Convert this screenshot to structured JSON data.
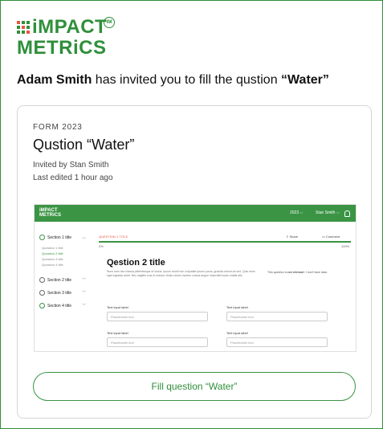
{
  "brand": {
    "line1": "iMPACT",
    "line2": "METRiCS",
    "tm": "IM"
  },
  "invite": {
    "inviter": "Adam Smith",
    "text_before": " has invited you to fill the qustion ",
    "question": "“Water”"
  },
  "card": {
    "form_label": "FORM 2023",
    "title": "Qustion “Water”",
    "invited_by": "Invited by Stan Smith",
    "last_edited": "Last edited 1 hour ago",
    "button_label": "Fill question “Water”"
  },
  "preview": {
    "logo_line1": "iMPACT",
    "logo_line2": "METRiCS",
    "year": "2023 ⌵",
    "user": "Stan Smith ⌵",
    "sections": [
      {
        "label": "Section 1 title"
      },
      {
        "label": "Section 2 title"
      },
      {
        "label": "Section 3 title"
      },
      {
        "label": "Section 4 title"
      }
    ],
    "subquestions": [
      "Question 1 title",
      "Question 2 title",
      "Question 3 title",
      "Question 4 title"
    ],
    "crumb": "QUESTION 1 TITLE",
    "share": "Share",
    "comment": "Comment",
    "progress_left": "0%",
    "progress_right": "100%",
    "question_title": "Qestion 2 title",
    "description": "Nunc sem nec massa pellentesque id luctus. Ipsum morbi non vulputate ipsum purus, gravida viverra at sed. Quis enim eget egestas amet. Nec sagittis cras et massa. Nulla rutrum montes cursus augue imperdiet turpis mattis alis.",
    "not_relevant_prefix": "This question is ",
    "not_relevant_bold": "not relevant",
    "not_relevant_suffix": " / I don't have data.",
    "fields": [
      {
        "label": "Text input label",
        "placeholder": "Placeholder text"
      },
      {
        "label": "Text input label",
        "placeholder": "Placeholder text"
      },
      {
        "label": "Text input label",
        "placeholder": "Placeholder text"
      },
      {
        "label": "Text input label",
        "placeholder": "Placeholder text"
      }
    ]
  },
  "colors": {
    "brand_green": "#2f8f3a",
    "accent_red": "#e5573f"
  }
}
